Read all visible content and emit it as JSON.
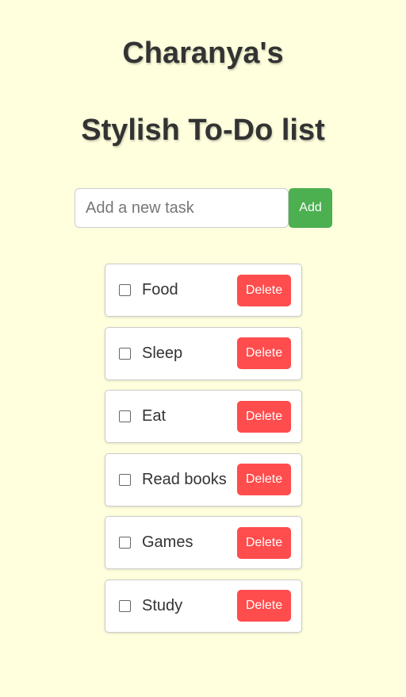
{
  "header": {
    "title_line1": "Charanya's",
    "title_line2": "Stylish To-Do list"
  },
  "new_task": {
    "value": "",
    "placeholder": "Add a new task",
    "add_label": "Add"
  },
  "tasks": [
    {
      "label": "Food",
      "checked": false,
      "delete_label": "Delete"
    },
    {
      "label": "Sleep",
      "checked": false,
      "delete_label": "Delete"
    },
    {
      "label": "Eat",
      "checked": false,
      "delete_label": "Delete"
    },
    {
      "label": "Read books",
      "checked": false,
      "delete_label": "Delete"
    },
    {
      "label": "Games",
      "checked": false,
      "delete_label": "Delete"
    },
    {
      "label": "Study",
      "checked": false,
      "delete_label": "Delete"
    }
  ],
  "colors": {
    "background": "#ffffde",
    "add_button": "#4caf50",
    "delete_button": "#ff4c4c",
    "text": "#333333"
  }
}
